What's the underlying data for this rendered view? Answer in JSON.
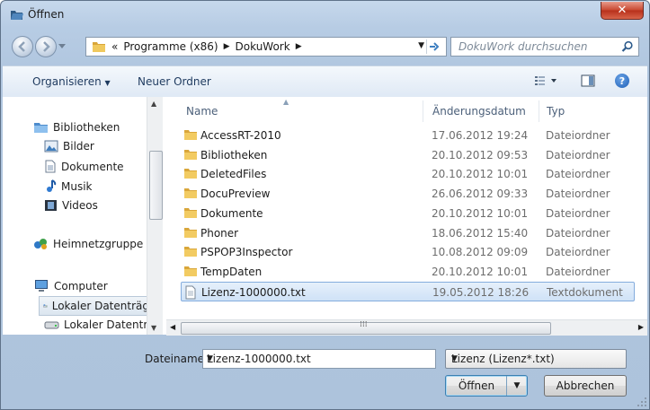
{
  "window": {
    "title": "Öffnen"
  },
  "address": {
    "overflow": "«",
    "crumbs": [
      "Programme (x86)",
      "DokuWork"
    ]
  },
  "search": {
    "placeholder": "DokuWork durchsuchen"
  },
  "toolbar": {
    "organize": "Organisieren",
    "new_folder": "Neuer Ordner"
  },
  "navpane": {
    "items": [
      {
        "label": "Bibliotheken",
        "icon": "library-icon"
      },
      {
        "label": "Bilder",
        "icon": "pictures-icon"
      },
      {
        "label": "Dokumente",
        "icon": "documents-icon"
      },
      {
        "label": "Musik",
        "icon": "music-icon"
      },
      {
        "label": "Videos",
        "icon": "videos-icon"
      },
      {
        "label": "Heimnetzgruppe",
        "icon": "homegroup-icon"
      },
      {
        "label": "Computer",
        "icon": "computer-icon"
      },
      {
        "label": "Lokaler Datenträg",
        "icon": "drive-icon"
      },
      {
        "label": "Lokaler Datenträg",
        "icon": "drive-icon"
      }
    ]
  },
  "columns": {
    "name": "Name",
    "date": "Änderungsdatum",
    "type": "Typ"
  },
  "files": [
    {
      "name": "AccessRT-2010",
      "date": "17.06.2012 19:24",
      "type": "Dateiordner",
      "kind": "folder"
    },
    {
      "name": "Bibliotheken",
      "date": "20.10.2012 09:53",
      "type": "Dateiordner",
      "kind": "folder"
    },
    {
      "name": "DeletedFiles",
      "date": "20.10.2012 10:01",
      "type": "Dateiordner",
      "kind": "folder"
    },
    {
      "name": "DocuPreview",
      "date": "26.06.2012 09:33",
      "type": "Dateiordner",
      "kind": "folder"
    },
    {
      "name": "Dokumente",
      "date": "20.10.2012 10:01",
      "type": "Dateiordner",
      "kind": "folder"
    },
    {
      "name": "Phoner",
      "date": "18.06.2012 15:40",
      "type": "Dateiordner",
      "kind": "folder"
    },
    {
      "name": "PSPOP3Inspector",
      "date": "10.08.2012 09:09",
      "type": "Dateiordner",
      "kind": "folder"
    },
    {
      "name": "TempDaten",
      "date": "20.10.2012 10:01",
      "type": "Dateiordner",
      "kind": "folder"
    },
    {
      "name": "Lizenz-1000000.txt",
      "date": "19.05.2012 18:26",
      "type": "Textdokument",
      "kind": "text-file"
    }
  ],
  "footer": {
    "filename_label": "Dateiname:",
    "filename_value": "Lizenz-1000000.txt",
    "filter_value": "Lizenz (Lizenz*.txt)",
    "open_label": "Öffnen",
    "cancel_label": "Abbrechen"
  },
  "colors": {
    "selection": "#cfe2f7",
    "close": "#c8462f",
    "folder": "#e8b84a"
  }
}
